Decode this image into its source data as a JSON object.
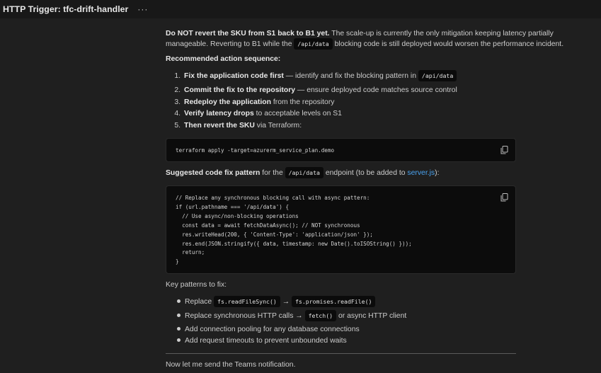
{
  "header": {
    "title": "HTTP Trigger: tfc-drift-handler",
    "more_label": "···"
  },
  "intro": {
    "bold": "Do NOT revert the SKU from S1 back to B1 yet.",
    "rest1": " The scale-up is currently the only mitigation keeping latency partially",
    "line2_pre": "manageable. Reverting to B1 while the ",
    "code": "/api/data",
    "line2_post": " blocking code is still deployed would worsen the performance incident."
  },
  "recommended_heading": "Recommended action sequence:",
  "steps": [
    {
      "num": "1.",
      "bold": "Fix the application code first",
      "rest": " — identify and fix the blocking pattern in ",
      "code": "/api/data"
    },
    {
      "num": "2.",
      "bold": "Commit the fix to the repository",
      "rest": " — ensure deployed code matches source control"
    },
    {
      "num": "3.",
      "bold": "Redeploy the application",
      "rest": " from the repository"
    },
    {
      "num": "4.",
      "bold": "Verify latency drops",
      "rest": " to acceptable levels on S1"
    },
    {
      "num": "5.",
      "bold": "Then revert the SKU",
      "rest": " via Terraform:"
    }
  ],
  "terraform_code": "terraform apply -target=azurerm_service_plan.demo",
  "suggested": {
    "bold": "Suggested code fix pattern",
    "mid": " for the ",
    "code": "/api/data",
    "post": " endpoint (to be added to ",
    "link": "server.js",
    "end": "):"
  },
  "fix_code": "// Replace any synchronous blocking call with async pattern:\nif (url.pathname === '/api/data') {\n  // Use async/non-blocking operations\n  const data = await fetchDataAsync(); // NOT synchronous\n  res.writeHead(200, { 'Content-Type': 'application/json' });\n  res.end(JSON.stringify({ data, timestamp: new Date().toISOString() }));\n  return;\n}",
  "key_patterns_heading": "Key patterns to fix:",
  "patterns": {
    "p1_pre": "Replace ",
    "p1_code1": "fs.readFileSync()",
    "p1_arrow": " → ",
    "p1_code2": "fs.promises.readFile()",
    "p2_pre": "Replace synchronous HTTP calls → ",
    "p2_code": "fetch()",
    "p2_post": " or async HTTP client",
    "p3": "Add connection pooling for any database connections",
    "p4": "Add request timeouts to prevent unbounded waits"
  },
  "closing": "Now let me send the Teams notification."
}
